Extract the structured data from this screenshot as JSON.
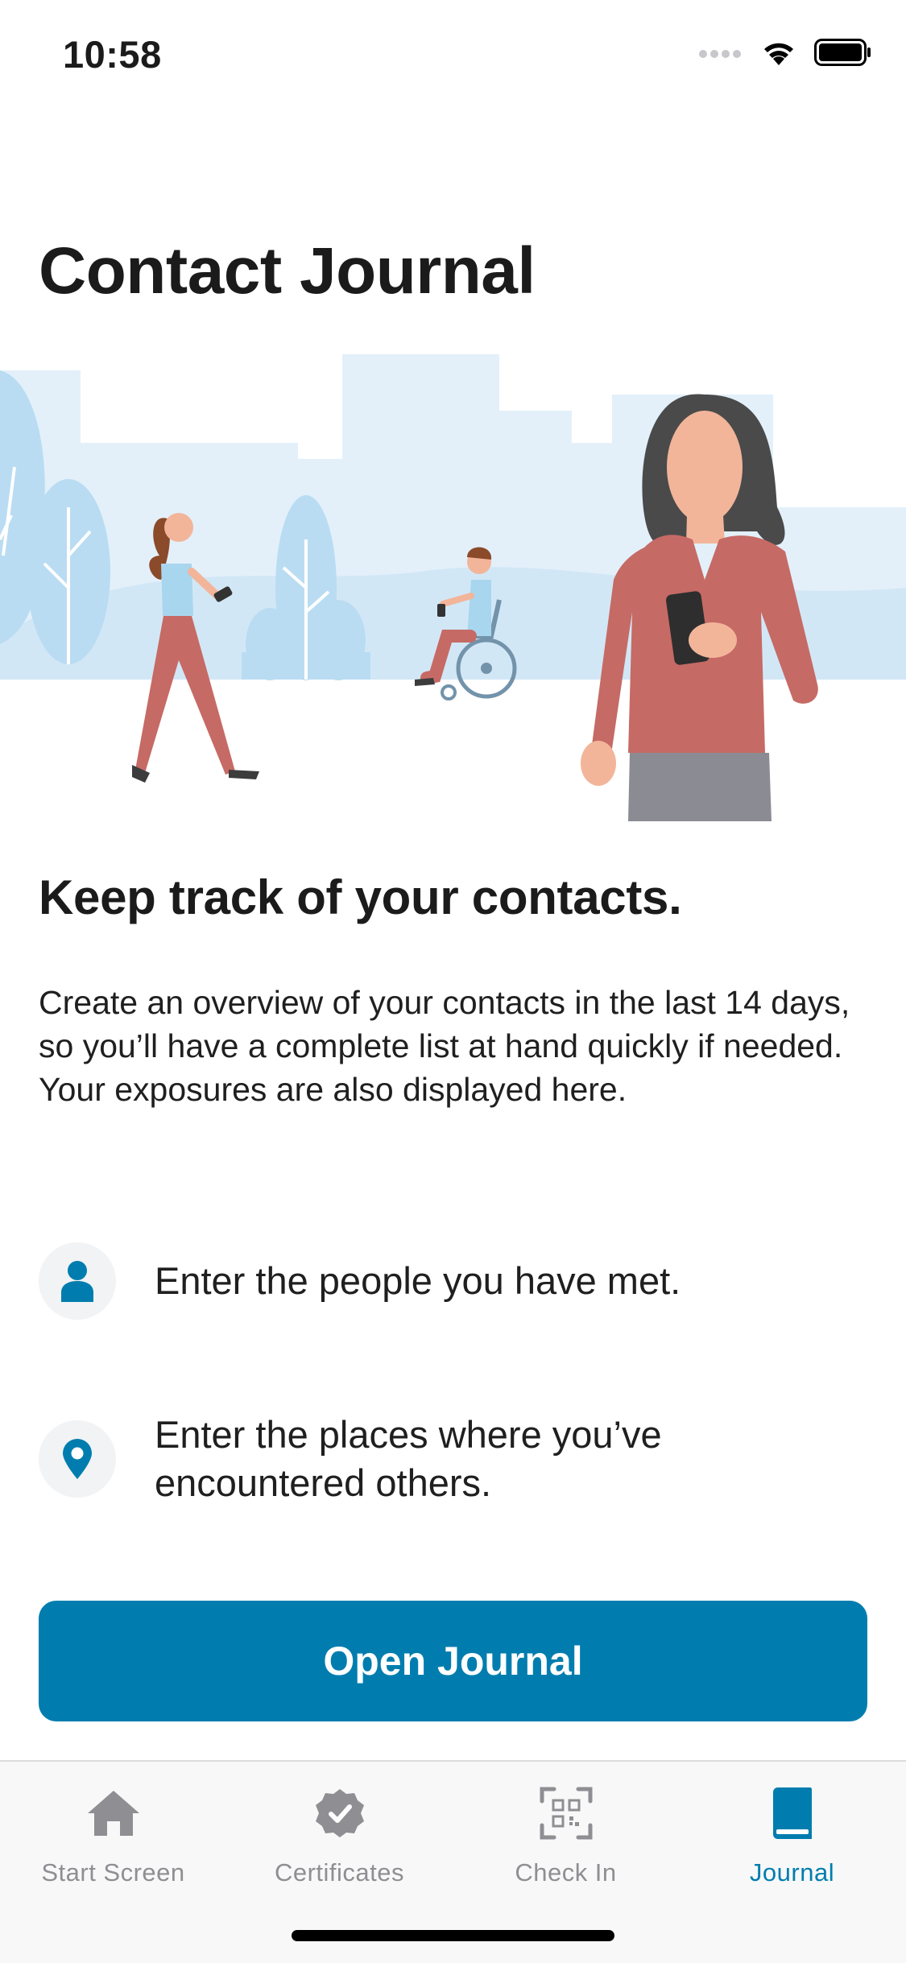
{
  "status_bar": {
    "time": "10:58",
    "icons": [
      "cellular-signal-icon",
      "wifi-icon",
      "battery-icon"
    ]
  },
  "page": {
    "title": "Contact Journal",
    "headline": "Keep track of your contacts.",
    "description": "Create an overview of your contacts in the last 14 days, so you’ll have a complete list at hand quickly if needed. Your exposures are also displayed here."
  },
  "features": [
    {
      "icon": "person-icon",
      "text": "Enter the people you have met."
    },
    {
      "icon": "location-pin-icon",
      "text": "Enter the places where you’ve encountered others."
    }
  ],
  "primary_button": {
    "label": "Open Journal"
  },
  "tab_bar": {
    "tabs": [
      {
        "icon": "home-icon",
        "label": "Start Screen",
        "active": false
      },
      {
        "icon": "certificate-badge-icon",
        "label": "Certificates",
        "active": false
      },
      {
        "icon": "qr-code-icon",
        "label": "Check In",
        "active": false
      },
      {
        "icon": "book-icon",
        "label": "Journal",
        "active": true
      }
    ]
  },
  "colors": {
    "accent": "#007dae",
    "inactive_tab": "#8e8e93",
    "icon_circle_bg": "#f1f3f5",
    "illustration_sky": "#e3f0fa",
    "illustration_tree": "#b9dcf2",
    "shirt": "#c66a65"
  }
}
